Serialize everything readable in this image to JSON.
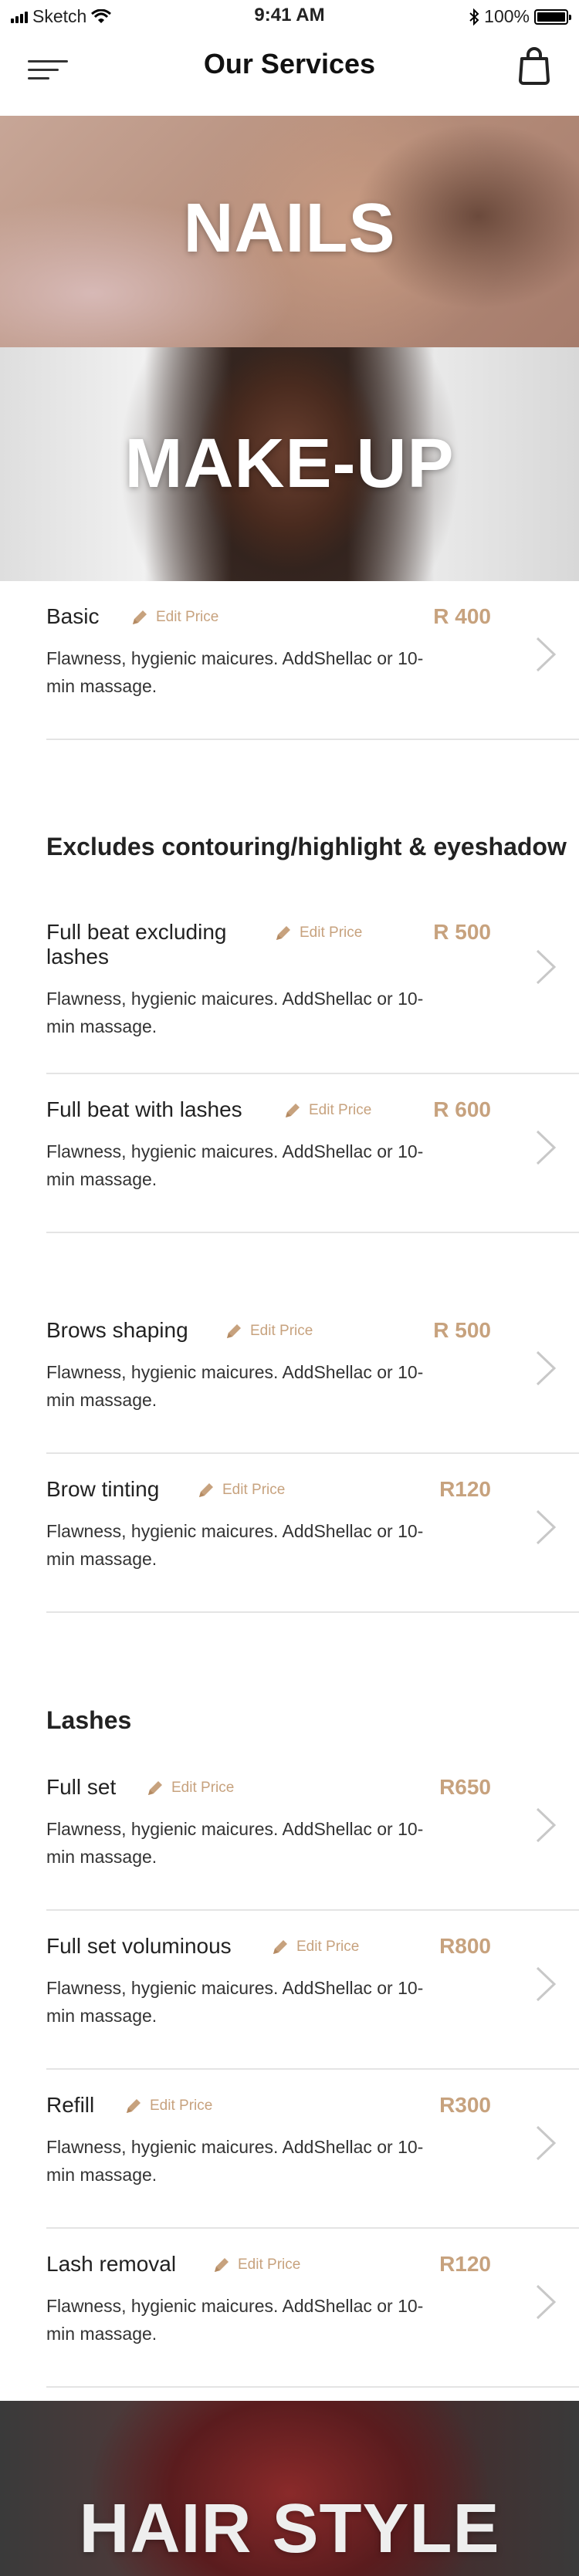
{
  "status_bar": {
    "carrier": "Sketch",
    "time": "9:41 AM",
    "battery": "100%"
  },
  "nav": {
    "title": "Our Services"
  },
  "banners": {
    "nails": "NAILS",
    "makeup": "MAKE-UP",
    "hairstyle": "HAIR STYLE"
  },
  "sections": {
    "contouring": "Excludes contouring/highlight & eyeshadow",
    "lashes": "Lashes"
  },
  "edit_label": "Edit Price",
  "items": [
    {
      "name": "Basic",
      "price": "R 400",
      "description": "Flawness, hygienic maicures. AddShellac or 10-min massage."
    },
    {
      "name": "Full beat excluding lashes",
      "price": "R 500",
      "description": "Flawness, hygienic maicures. AddShellac or 10-min massage."
    },
    {
      "name": "Full beat with lashes",
      "price": "R 600",
      "description": "Flawness, hygienic maicures. AddShellac or 10-min massage."
    },
    {
      "name": "Brows shaping",
      "price": "R 500",
      "description": "Flawness, hygienic maicures. AddShellac or 10-min massage."
    },
    {
      "name": "Brow tinting",
      "price": "R120",
      "description": "Flawness, hygienic maicures. AddShellac or 10-min massage."
    },
    {
      "name": "Full set",
      "price": "R650",
      "description": "Flawness, hygienic maicures. AddShellac or 10-min massage."
    },
    {
      "name": "Full set voluminous",
      "price": "R800",
      "description": "Flawness, hygienic maicures. AddShellac or 10-min massage."
    },
    {
      "name": "Refill",
      "price": "R300",
      "description": "Flawness, hygienic maicures. AddShellac or 10-min massage."
    },
    {
      "name": "Lash removal",
      "price": "R120",
      "description": "Flawness, hygienic maicures. AddShellac or 10-min massage."
    }
  ],
  "colors": {
    "accent": "#c7a27e",
    "text": "#222222",
    "divider": "#e4e4e4"
  }
}
